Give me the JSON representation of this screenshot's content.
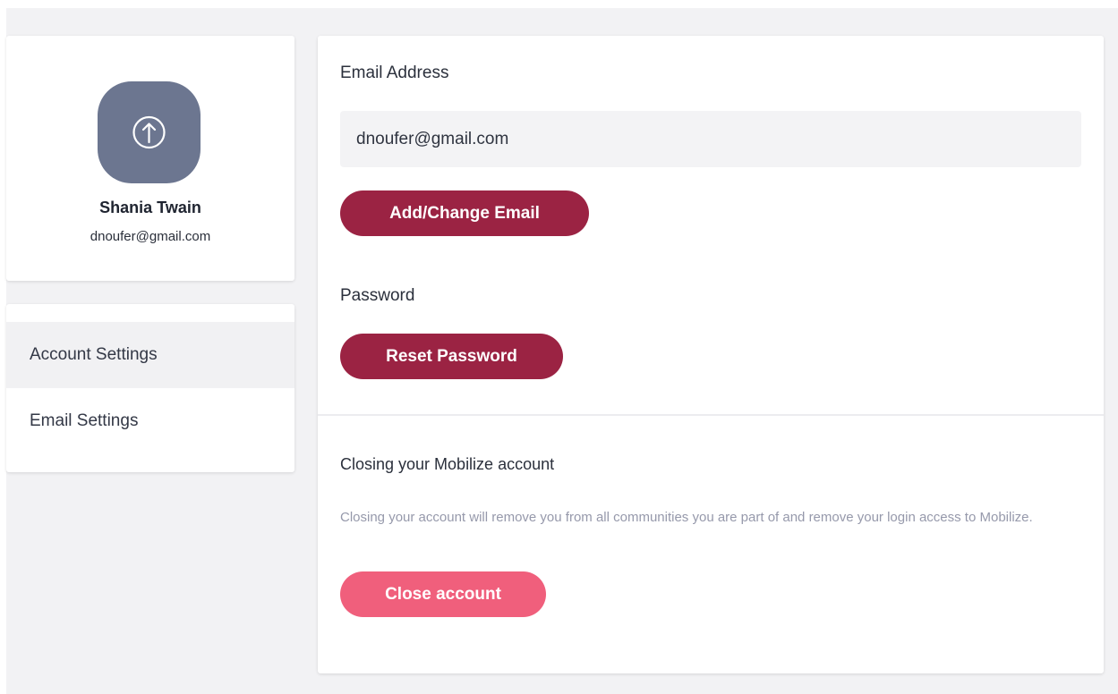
{
  "profile": {
    "avatar_icon": "upload-icon",
    "name": "Shania Twain",
    "email": "dnoufer@gmail.com"
  },
  "sidebar": {
    "items": [
      {
        "label": "Account Settings",
        "active": true
      },
      {
        "label": "Email Settings",
        "active": false
      }
    ]
  },
  "account": {
    "email_label": "Email Address",
    "email_value": "dnoufer@gmail.com",
    "change_email_button": "Add/Change Email",
    "password_label": "Password",
    "reset_password_button": "Reset Password",
    "close_title": "Closing your Mobilize account",
    "close_description": "Closing your account will remove you from all communities you are part of and remove your login access to Mobilize.",
    "close_button": "Close account"
  },
  "colors": {
    "primary_button": "#9b2343",
    "danger_button": "#f05f7c",
    "avatar_bg": "#6c7690",
    "background": "#f2f2f4"
  }
}
